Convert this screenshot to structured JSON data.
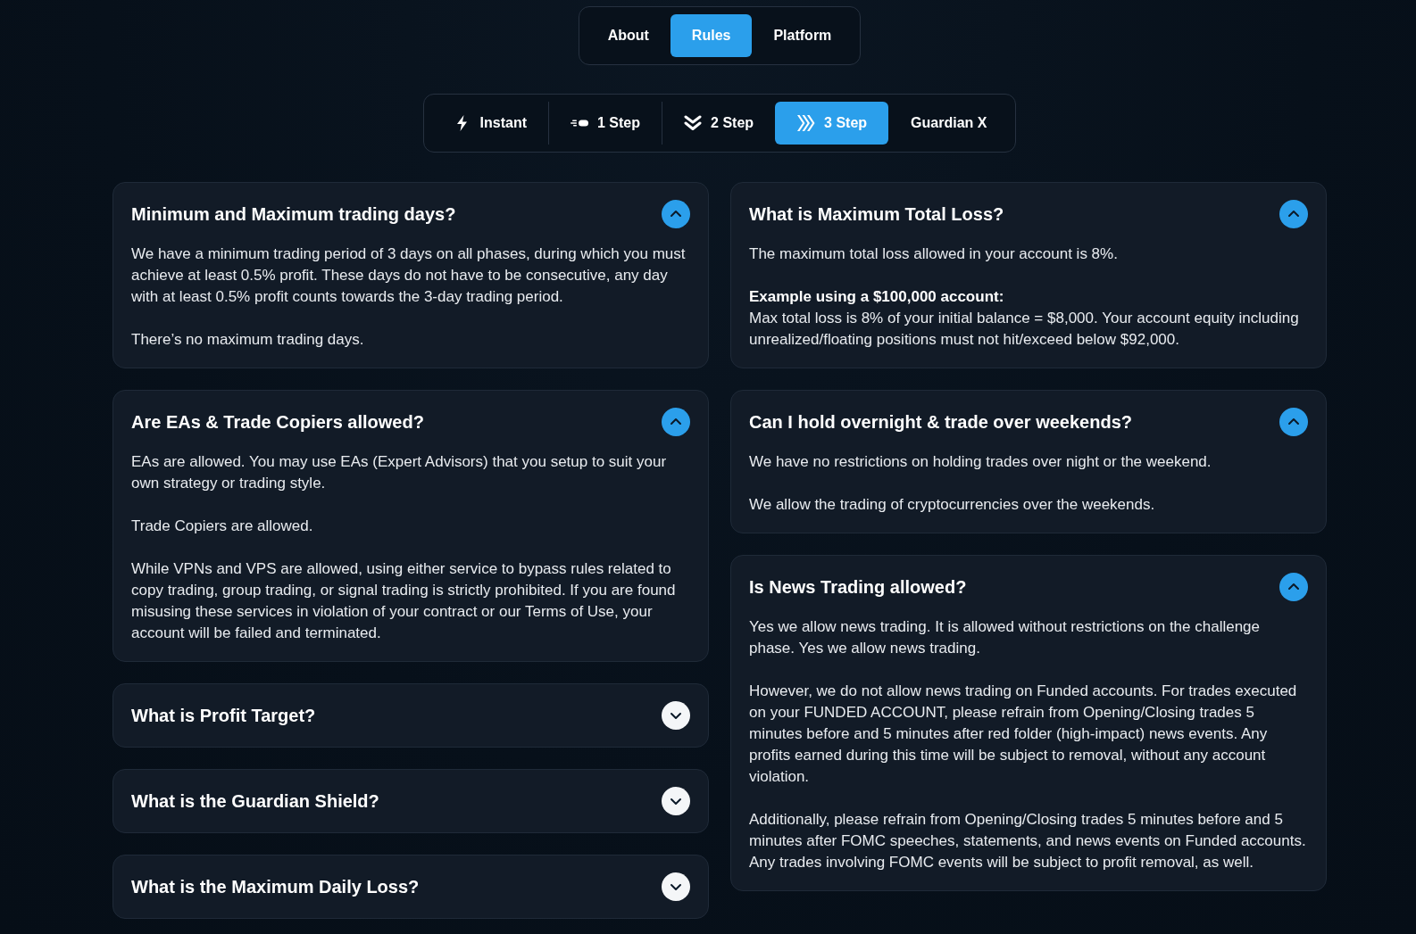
{
  "section_tabs": [
    {
      "label": "About",
      "selected": false
    },
    {
      "label": "Rules",
      "selected": true
    },
    {
      "label": "Platform",
      "selected": false
    }
  ],
  "plan_tabs": [
    {
      "label": "Instant",
      "selected": false
    },
    {
      "label": "1 Step",
      "selected": false
    },
    {
      "label": "2 Step",
      "selected": false
    },
    {
      "label": "3 Step",
      "selected": true
    },
    {
      "label": "Guardian X",
      "selected": false
    }
  ],
  "faq": {
    "left_column": [
      {
        "question": "Minimum and Maximum trading days?",
        "expanded": true,
        "answer": [
          "We have a minimum trading period of 3 days on all phases, during which you must achieve at least 0.5% profit. These days do not have to be consecutive, any day with at least 0.5% profit counts towards the 3-day trading period.",
          "There’s no maximum trading days."
        ]
      },
      {
        "question": "Are EAs & Trade Copiers allowed?",
        "expanded": true,
        "answer": [
          "EAs are allowed. You may use EAs (Expert Advisors) that you setup to suit your own strategy or trading style.",
          "Trade Copiers are allowed.",
          "While VPNs and VPS are allowed, using either service to bypass rules related to copy trading, group trading, or signal trading is strictly prohibited. If you are found misusing these services in violation of your contract or our Terms of Use, your account will be failed and terminated."
        ]
      },
      {
        "question": "What is Profit Target?",
        "expanded": false
      },
      {
        "question": "What is the Guardian Shield?",
        "expanded": false
      },
      {
        "question": "What is the Maximum Daily Loss?",
        "expanded": false
      }
    ],
    "right_column": [
      {
        "question": "What is Maximum Total Loss?",
        "expanded": true,
        "answer": [
          "The maximum total loss allowed in your account is 8%.",
          "**Example using a $100,000 account:**\nMax total loss is 8% of your initial balance = $8,000. Your account equity including unrealized/floating positions must not hit/exceed below $92,000."
        ]
      },
      {
        "question": "Can I hold overnight & trade over weekends?",
        "expanded": true,
        "answer": [
          "We have no restrictions on holding trades over night or the weekend.",
          "We allow the trading of cryptocurrencies over the weekends."
        ]
      },
      {
        "question": "Is News Trading allowed?",
        "expanded": true,
        "answer": [
          "Yes we allow news trading. It is allowed without restrictions on the challenge phase. Yes we allow news trading.",
          "However, we do not allow news trading on Funded accounts. For trades executed on your FUNDED ACCOUNT, please refrain from Opening/Closing trades 5 minutes before and 5 minutes after red folder (high-impact) news events. Any profits earned during this time will be subject to removal, without any account violation.",
          "Additionally, please refrain from Opening/Closing trades 5 minutes before and 5 minutes after FOMC speeches, statements, and news events on Funded accounts. Any trades involving FOMC events will be subject to profit removal, as well."
        ]
      }
    ]
  }
}
